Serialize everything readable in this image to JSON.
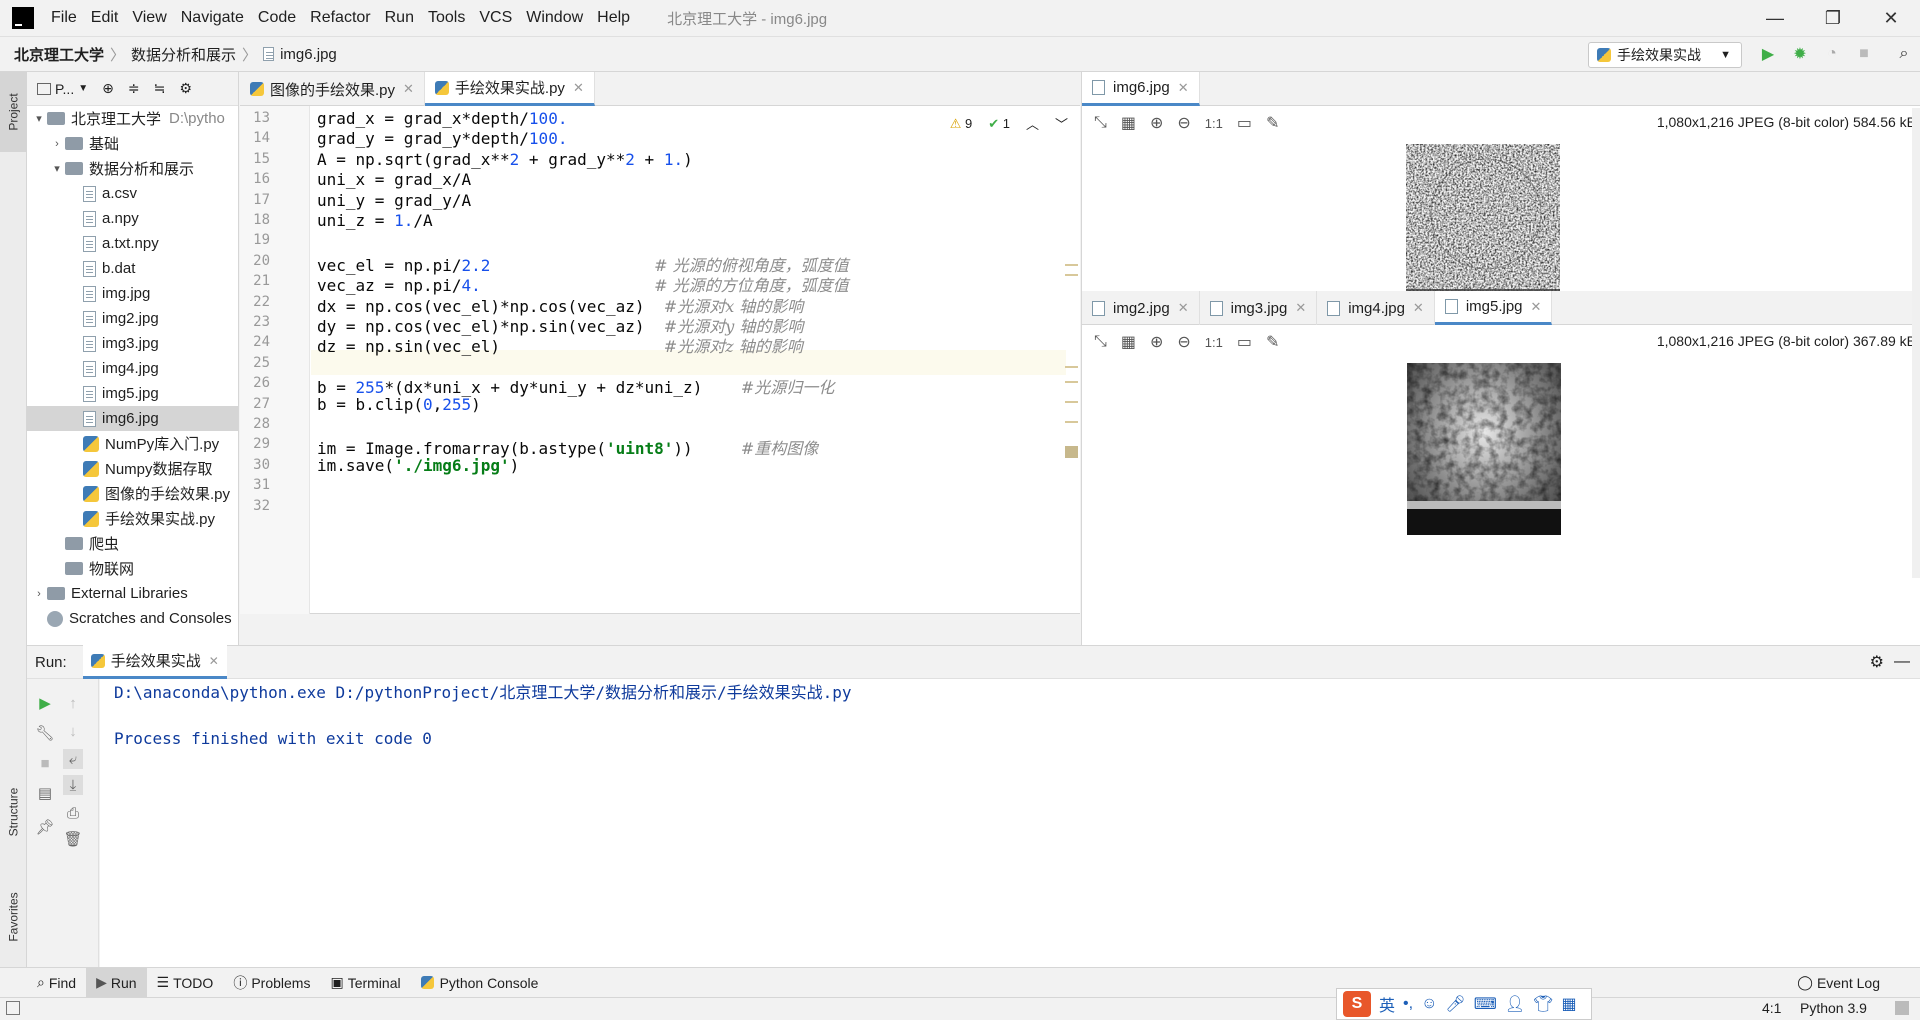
{
  "menubar": {
    "items": [
      "File",
      "Edit",
      "View",
      "Navigate",
      "Code",
      "Refactor",
      "Run",
      "Tools",
      "VCS",
      "Window",
      "Help"
    ],
    "title": "北京理工大学 - img6.jpg"
  },
  "navbar": {
    "crumbs": [
      "北京理工大学",
      "数据分析和展示",
      "img6.jpg"
    ],
    "run_config": "手绘效果实战"
  },
  "left_stripe": {
    "project": "Project",
    "structure": "Structure",
    "favorites": "Favorites"
  },
  "project": {
    "toolbar_label": "P...",
    "tree": [
      {
        "label": "北京理工大学",
        "hint": "D:\\pytho",
        "kind": "folder",
        "arrow": "▾",
        "indent": 0
      },
      {
        "label": "基础",
        "kind": "folder",
        "arrow": "›",
        "indent": 1
      },
      {
        "label": "数据分析和展示",
        "kind": "folder",
        "arrow": "▾",
        "indent": 1
      },
      {
        "label": "a.csv",
        "kind": "file",
        "indent": 2
      },
      {
        "label": "a.npy",
        "kind": "file",
        "indent": 2
      },
      {
        "label": "a.txt.npy",
        "kind": "file",
        "indent": 2
      },
      {
        "label": "b.dat",
        "kind": "file",
        "indent": 2
      },
      {
        "label": "img.jpg",
        "kind": "file",
        "indent": 2
      },
      {
        "label": "img2.jpg",
        "kind": "file",
        "indent": 2
      },
      {
        "label": "img3.jpg",
        "kind": "file",
        "indent": 2
      },
      {
        "label": "img4.jpg",
        "kind": "file",
        "indent": 2
      },
      {
        "label": "img5.jpg",
        "kind": "file",
        "indent": 2
      },
      {
        "label": "img6.jpg",
        "kind": "file",
        "indent": 2,
        "selected": true
      },
      {
        "label": "NumPy库入门.py",
        "kind": "py",
        "indent": 2
      },
      {
        "label": "Numpy数据存取",
        "kind": "py",
        "indent": 2
      },
      {
        "label": "图像的手绘效果.py",
        "kind": "py",
        "indent": 2
      },
      {
        "label": "手绘效果实战.py",
        "kind": "py",
        "indent": 2
      },
      {
        "label": "爬虫",
        "kind": "folder",
        "indent": 1
      },
      {
        "label": "物联网",
        "kind": "folder",
        "indent": 1
      },
      {
        "label": "External Libraries",
        "kind": "lib",
        "arrow": "›",
        "indent": 0
      },
      {
        "label": "Scratches and Consoles",
        "kind": "scratch",
        "indent": 0
      }
    ]
  },
  "editor": {
    "tabs": [
      {
        "label": "图像的手绘效果.py",
        "active": false
      },
      {
        "label": "手绘效果实战.py",
        "active": true
      }
    ],
    "inspections": {
      "warnings": "9",
      "ok": "1"
    },
    "lines": [
      {
        "n": "13",
        "html": "grad_x = grad_x*depth/<span class=\"num\">100.</span>"
      },
      {
        "n": "14",
        "html": "grad_y = grad_y*depth/<span class=\"num\">100.</span>"
      },
      {
        "n": "15",
        "html": "A = np.sqrt(grad_x**<span class=\"num\">2</span> + grad_y**<span class=\"num\">2</span> + <span class=\"num\">1.</span>)"
      },
      {
        "n": "16",
        "html": "uni_x = grad_x/A"
      },
      {
        "n": "17",
        "html": "uni_y = grad_y/A"
      },
      {
        "n": "18",
        "html": "uni_z = <span class=\"num\">1.</span>/A"
      },
      {
        "n": "19",
        "html": ""
      },
      {
        "n": "20",
        "html": "vec_el = np.pi/<span class=\"num\">2.2</span>                 <span class=\"cmt\"># 光源的俯视角度，弧度值</span>"
      },
      {
        "n": "21",
        "html": "vec_az = np.pi/<span class=\"num\">4.</span>                  <span class=\"cmt\"># 光源的方位角度，弧度值</span>"
      },
      {
        "n": "22",
        "html": "dx = np.cos(vec_el)*np.cos(vec_az)  <span class=\"cmt\">#光源对x 轴的影响</span>"
      },
      {
        "n": "23",
        "html": "dy = np.cos(vec_el)*np.sin(vec_az)  <span class=\"cmt\">#光源对y 轴的影响</span>"
      },
      {
        "n": "24",
        "html": "dz = np.sin(vec_el)                 <span class=\"cmt\">#光源对z 轴的影响</span>"
      },
      {
        "n": "25",
        "html": ""
      },
      {
        "n": "26",
        "html": "b = <span class=\"num\">255</span>*(dx*uni_x + dy*uni_y + dz*uni_z)    <span class=\"cmt\">#光源归一化</span>"
      },
      {
        "n": "27",
        "html": "b = b.clip(<span class=\"num\">0</span>,<span class=\"num\">255</span>)"
      },
      {
        "n": "28",
        "html": ""
      },
      {
        "n": "29",
        "html": "im = Image.fromarray(b.astype(<span class=\"str\">'uint8'</span>))     <span class=\"cmt\">#重构图像</span>"
      },
      {
        "n": "30",
        "html": "im.save(<span class=\"str\">'./img6.jpg'</span>)"
      },
      {
        "n": "31",
        "html": ""
      },
      {
        "n": "32",
        "html": ""
      }
    ]
  },
  "viewer_top": {
    "tabs": [
      {
        "label": "img6.jpg",
        "active": true
      }
    ],
    "meta": "1,080x1,216 JPEG (8-bit color) 584.56 kB",
    "zoom_label": "1:1"
  },
  "viewer_bottom": {
    "tabs": [
      {
        "label": "img2.jpg",
        "active": false
      },
      {
        "label": "img3.jpg",
        "active": false
      },
      {
        "label": "img4.jpg",
        "active": false
      },
      {
        "label": "img5.jpg",
        "active": true
      }
    ],
    "meta": "1,080x1,216 JPEG (8-bit color) 367.89 kB",
    "zoom_label": "1:1"
  },
  "run": {
    "label": "Run:",
    "tab": "手绘效果实战",
    "console": [
      "D:\\anaconda\\python.exe D:/pythonProject/北京理工大学/数据分析和展示/手绘效果实战.py",
      "",
      "Process finished with exit code 0"
    ]
  },
  "bottom_tools": {
    "items": [
      "Find",
      "Run",
      "TODO",
      "Problems",
      "Terminal",
      "Python Console"
    ],
    "event_log": "Event Log"
  },
  "status": {
    "position": "4:1",
    "interpreter": "Python 3.9"
  },
  "ime": {
    "lang": "英"
  },
  "colors": {
    "accent": "#4a88c7",
    "run_green": "#3fae48",
    "console_text": "#0e3a9c"
  }
}
